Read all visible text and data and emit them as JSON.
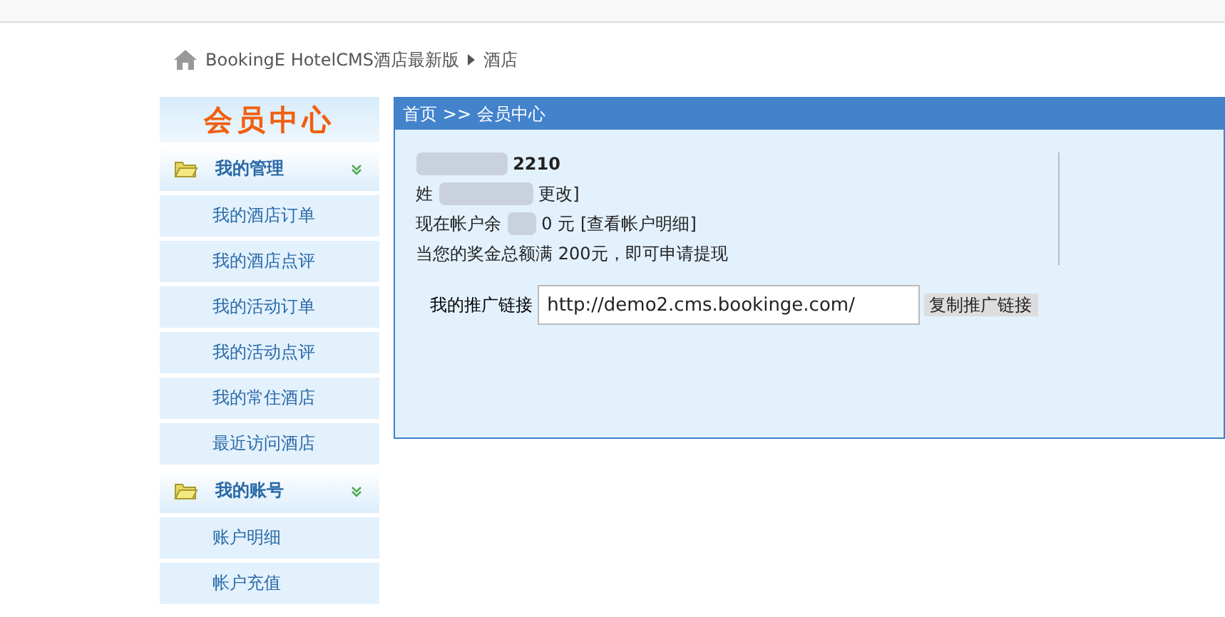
{
  "breadcrumb": {
    "site": "BookingE HotelCMS酒店最新版",
    "current": "酒店"
  },
  "sidebar": {
    "title": "会员中心",
    "groups": [
      {
        "label": "我的管理",
        "expanded": true,
        "items": [
          "我的酒店订单",
          "我的酒店点评",
          "我的活动订单",
          "我的活动点评",
          "我的常住酒店",
          "最近访问酒店"
        ]
      },
      {
        "label": "我的账号",
        "expanded": true,
        "items": [
          "账户明细",
          "帐户充值"
        ]
      }
    ]
  },
  "panel": {
    "path": "首页 >> 会员中心",
    "account_tail": "2210",
    "name_label": "姓",
    "change_link": "更改]",
    "balance_text": "现在帐户余",
    "balance_amount": "0 元",
    "balance_link": "[查看帐户明细]",
    "notice": "当您的奖金总额满 200元，即可申请提现",
    "referral_label": "我的推广链接",
    "referral_url": "http://demo2.cms.bookinge.com/",
    "copy_button": "复制推广链接"
  }
}
